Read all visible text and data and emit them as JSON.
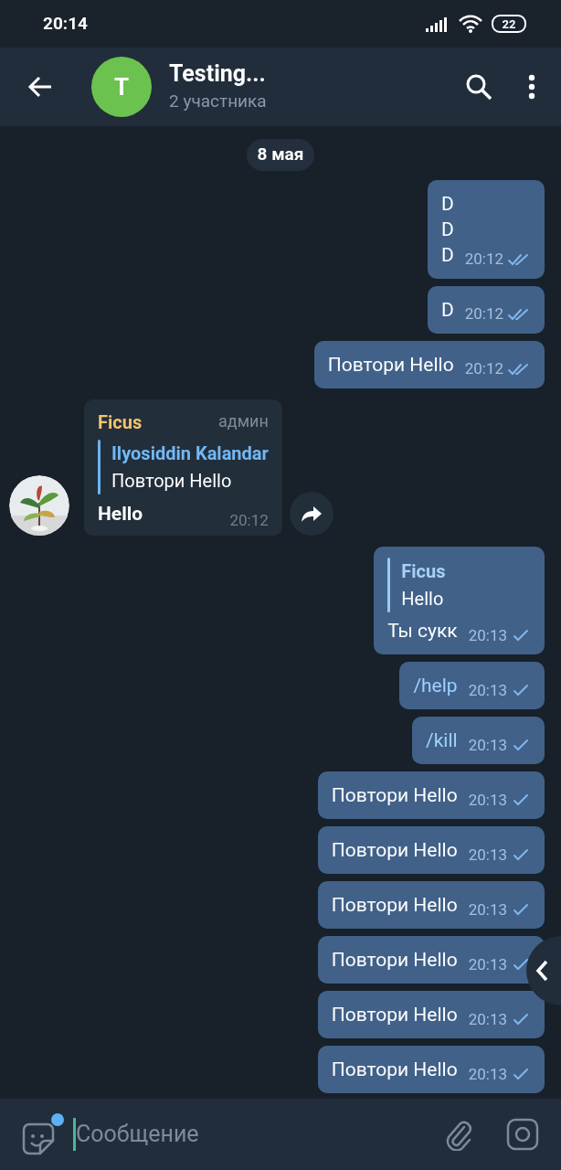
{
  "status_bar": {
    "time": "20:14",
    "battery": "22"
  },
  "header": {
    "avatar_letter": "T",
    "title": "Testing...",
    "subtitle": "2 участника"
  },
  "date_chip": "8 мая",
  "messages": [
    {
      "kind": "outgoing",
      "text": "D\nD\nD",
      "time": "20:12",
      "read": true,
      "command": false
    },
    {
      "kind": "outgoing",
      "text": "D",
      "time": "20:12",
      "read": true,
      "command": false
    },
    {
      "kind": "outgoing",
      "text": "Повтори Hello",
      "time": "20:12",
      "read": true,
      "command": false
    },
    {
      "kind": "incoming",
      "author": "Ficus",
      "role": "админ",
      "reply": {
        "author": "Ilyosiddin Kalandar",
        "text": "Повтори Hello"
      },
      "text": "Hello",
      "time": "20:12"
    },
    {
      "kind": "outgoing",
      "reply": {
        "author": "Ficus",
        "text": "Hello"
      },
      "text": "Ты сукк",
      "time": "20:13",
      "read": false,
      "command": false
    },
    {
      "kind": "outgoing",
      "text": "/help",
      "time": "20:13",
      "read": false,
      "command": true
    },
    {
      "kind": "outgoing",
      "text": "/kill",
      "time": "20:13",
      "read": false,
      "command": true
    },
    {
      "kind": "outgoing",
      "text": "Повтори Hello",
      "time": "20:13",
      "read": false,
      "command": false
    },
    {
      "kind": "outgoing",
      "text": "Повтори Hello",
      "time": "20:13",
      "read": false,
      "command": false
    },
    {
      "kind": "outgoing",
      "text": "Повтори Hello",
      "time": "20:13",
      "read": false,
      "command": false
    },
    {
      "kind": "outgoing",
      "text": "Повтори Hello",
      "time": "20:13",
      "read": false,
      "command": false
    },
    {
      "kind": "outgoing",
      "text": "Повтори Hello",
      "time": "20:13",
      "read": false,
      "command": false
    },
    {
      "kind": "outgoing",
      "text": "Повтори Hello",
      "time": "20:13",
      "read": false,
      "command": false
    }
  ],
  "composer": {
    "placeholder": "Сообщение",
    "sticker_badge": true
  }
}
